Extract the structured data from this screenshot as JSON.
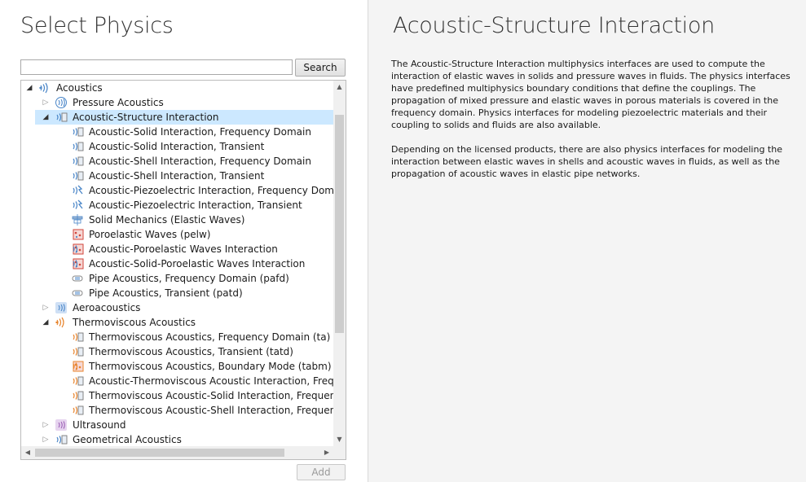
{
  "left": {
    "title": "Select Physics",
    "search": {
      "value": "",
      "placeholder": "",
      "button_label": "Search"
    },
    "add_button_label": "Add"
  },
  "tree": {
    "items": [
      {
        "label": "Acoustics",
        "level": 0,
        "expander": "open",
        "icon": "acoustics-icon",
        "selected": false
      },
      {
        "label": "Pressure Acoustics",
        "level": 1,
        "expander": "closed",
        "icon": "pressure-acoustics-icon",
        "selected": false
      },
      {
        "label": "Acoustic-Structure Interaction",
        "level": 1,
        "expander": "open",
        "icon": "acoustic-structure-icon",
        "selected": true
      },
      {
        "label": "Acoustic-Solid Interaction, Frequency Domain",
        "level": 2,
        "expander": "none",
        "icon": "acoustic-solid-icon",
        "selected": false
      },
      {
        "label": "Acoustic-Solid Interaction, Transient",
        "level": 2,
        "expander": "none",
        "icon": "acoustic-solid-transient-icon",
        "selected": false
      },
      {
        "label": "Acoustic-Shell Interaction, Frequency Domain",
        "level": 2,
        "expander": "none",
        "icon": "acoustic-shell-icon",
        "selected": false
      },
      {
        "label": "Acoustic-Shell Interaction, Transient",
        "level": 2,
        "expander": "none",
        "icon": "acoustic-shell-transient-icon",
        "selected": false
      },
      {
        "label": "Acoustic-Piezoelectric Interaction, Frequency Domain",
        "level": 2,
        "expander": "none",
        "icon": "acoustic-piezoelectric-icon",
        "selected": false
      },
      {
        "label": "Acoustic-Piezoelectric Interaction, Transient",
        "level": 2,
        "expander": "none",
        "icon": "acoustic-piezoelectric-transient-icon",
        "selected": false
      },
      {
        "label": "Solid Mechanics (Elastic Waves)",
        "level": 2,
        "expander": "none",
        "icon": "solid-mechanics-icon",
        "selected": false
      },
      {
        "label": "Poroelastic Waves (pelw)",
        "level": 2,
        "expander": "none",
        "icon": "poroelastic-waves-icon",
        "selected": false
      },
      {
        "label": "Acoustic-Poroelastic Waves Interaction",
        "level": 2,
        "expander": "none",
        "icon": "acoustic-poroelastic-icon",
        "selected": false
      },
      {
        "label": "Acoustic-Solid-Poroelastic Waves Interaction",
        "level": 2,
        "expander": "none",
        "icon": "acoustic-solid-poroelastic-icon",
        "selected": false
      },
      {
        "label": "Pipe Acoustics, Frequency Domain (pafd)",
        "level": 2,
        "expander": "none",
        "icon": "pipe-acoustics-icon",
        "selected": false
      },
      {
        "label": "Pipe Acoustics, Transient (patd)",
        "level": 2,
        "expander": "none",
        "icon": "pipe-acoustics-transient-icon",
        "selected": false
      },
      {
        "label": "Aeroacoustics",
        "level": 1,
        "expander": "closed",
        "icon": "aeroacoustics-icon",
        "selected": false
      },
      {
        "label": "Thermoviscous Acoustics",
        "level": 1,
        "expander": "open",
        "icon": "thermoviscous-acoustics-icon",
        "selected": false
      },
      {
        "label": "Thermoviscous Acoustics, Frequency Domain (ta)",
        "level": 2,
        "expander": "none",
        "icon": "thermoviscous-frequency-icon",
        "selected": false
      },
      {
        "label": "Thermoviscous Acoustics, Transient (tatd)",
        "level": 2,
        "expander": "none",
        "icon": "thermoviscous-transient-icon",
        "selected": false
      },
      {
        "label": "Thermoviscous Acoustics, Boundary Mode (tabm)",
        "level": 2,
        "expander": "none",
        "icon": "thermoviscous-boundary-icon",
        "selected": false
      },
      {
        "label": "Acoustic-Thermoviscous Acoustic Interaction, Frequency",
        "level": 2,
        "expander": "none",
        "icon": "acoustic-thermoviscous-icon",
        "selected": false
      },
      {
        "label": "Thermoviscous Acoustic-Solid Interaction, Frequency Do",
        "level": 2,
        "expander": "none",
        "icon": "thermoviscous-solid-icon",
        "selected": false
      },
      {
        "label": "Thermoviscous Acoustic-Shell Interaction, Frequency Do",
        "level": 2,
        "expander": "none",
        "icon": "thermoviscous-shell-icon",
        "selected": false
      },
      {
        "label": "Ultrasound",
        "level": 1,
        "expander": "closed",
        "icon": "ultrasound-icon",
        "selected": false
      },
      {
        "label": "Geometrical Acoustics",
        "level": 1,
        "expander": "closed",
        "icon": "geometrical-acoustics-icon",
        "selected": false
      }
    ]
  },
  "right": {
    "title": "Acoustic-Structure Interaction",
    "paragraphs": [
      "The Acoustic-Structure Interaction multiphysics interfaces are used to compute the interaction of elastic waves in solids and pressure waves in fluids. The physics interfaces have predefined multiphysics boundary conditions that define the couplings. The propagation of mixed pressure and elastic waves in porous materials is covered in the frequency domain. Physics interfaces for modeling piezoelectric materials and their coupling to solids and fluids are also available.",
      "Depending on the licensed products, there are also physics interfaces for modeling the interaction between elastic waves in shells and acoustic waves in fluids, as well as the propagation of acoustic waves in elastic pipe networks."
    ]
  },
  "colors": {
    "selection": "#cce8ff",
    "acoustics_blue": "#4a86c8",
    "thermoviscous_orange": "#e8842c",
    "ultrasound_purple": "#9c5fb5"
  }
}
